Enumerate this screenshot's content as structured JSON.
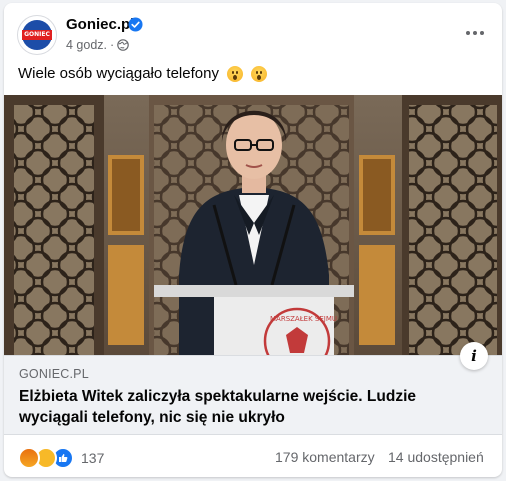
{
  "post": {
    "page_name": "Goniec.pl",
    "avatar_text": "GONIEC",
    "time": "4 godz.",
    "dot": "·",
    "text": "Wiele osób wyciągało telefony",
    "icons": {
      "verified": "verified-badge-icon",
      "audience": "globe-icon",
      "more": "more-options-icon",
      "info": "info-icon"
    }
  },
  "photo": {
    "podium_text": "MARSZAŁEK SEJMU"
  },
  "link_preview": {
    "domain": "GONIEC.PL",
    "title": "Elżbieta Witek zaliczyła spektakularne wejście. Ludzie wyciągali telefony, nic się nie ukryło",
    "info_label": "i"
  },
  "footer": {
    "reaction_count": "137",
    "comments": "179 komentarzy",
    "shares": "14 udostępnień"
  },
  "colors": {
    "accent": "#1877f2",
    "secondary_text": "#65676b",
    "brand_red": "#e02020"
  }
}
